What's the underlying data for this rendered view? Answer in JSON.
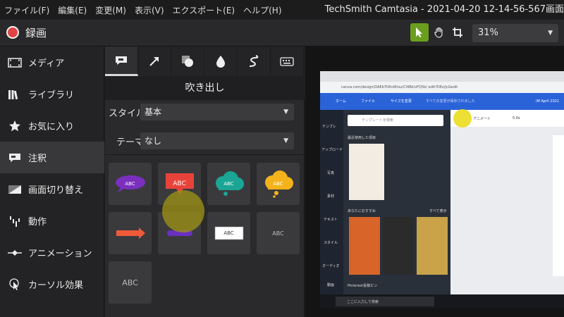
{
  "menu": [
    "ファイル(F)",
    "編集(E)",
    "変更(M)",
    "表示(V)",
    "エクスポート(E)",
    "ヘルプ(H)"
  ],
  "window_title": "TechSmith Camtasia - 2021-04-20 12-14-56-567画面",
  "toolbar": {
    "record_label": "録画",
    "zoom": "31%"
  },
  "sidebar": [
    {
      "label": "メディア",
      "icon": "film-icon"
    },
    {
      "label": "ライブラリ",
      "icon": "library-icon"
    },
    {
      "label": "お気に入り",
      "icon": "star-icon"
    },
    {
      "label": "注釈",
      "icon": "annotation-icon"
    },
    {
      "label": "画面切り替え",
      "icon": "transition-icon"
    },
    {
      "label": "動作",
      "icon": "behavior-icon"
    },
    {
      "label": "アニメーション",
      "icon": "animation-icon"
    },
    {
      "label": "カーソル効果",
      "icon": "cursor-effect-icon"
    }
  ],
  "panel": {
    "title": "吹き出し",
    "style_label": "スタイル",
    "style_value": "基本",
    "theme_label": "テーマ",
    "theme_value": "なし",
    "preset_text": "ABC"
  },
  "recording": {
    "address": "canva.com/design/DAEb7hRvW/ou/CI4Bk/vFQ5b/ edit?DEo/jcGedit",
    "canva_home": "ホーム",
    "canva_file": "ファイル",
    "canva_resize": "サイズを変更",
    "canva_saved": "すべての変更が保存されました",
    "canva_title": "IM April 2021",
    "search_placeholder": "テンプレートを検索",
    "recent_label": "最近使用した項目",
    "recommend_label": "あなたにおすすめ",
    "see_all": "すべて表示",
    "pinterest_label": "Pinterest投稿ピン",
    "animate_label": "アニメート",
    "duration": "5.0s",
    "taskbar_search": "ここに入力して検索",
    "left_rail": [
      "テンプレ",
      "アップロード",
      "写真",
      "素材",
      "テキスト",
      "スタイル",
      "オーディオ",
      "動画"
    ]
  },
  "colors": {
    "accent_green": "#6b9e1f",
    "record_red": "#e04545",
    "canva_blue": "#2a62d8"
  }
}
